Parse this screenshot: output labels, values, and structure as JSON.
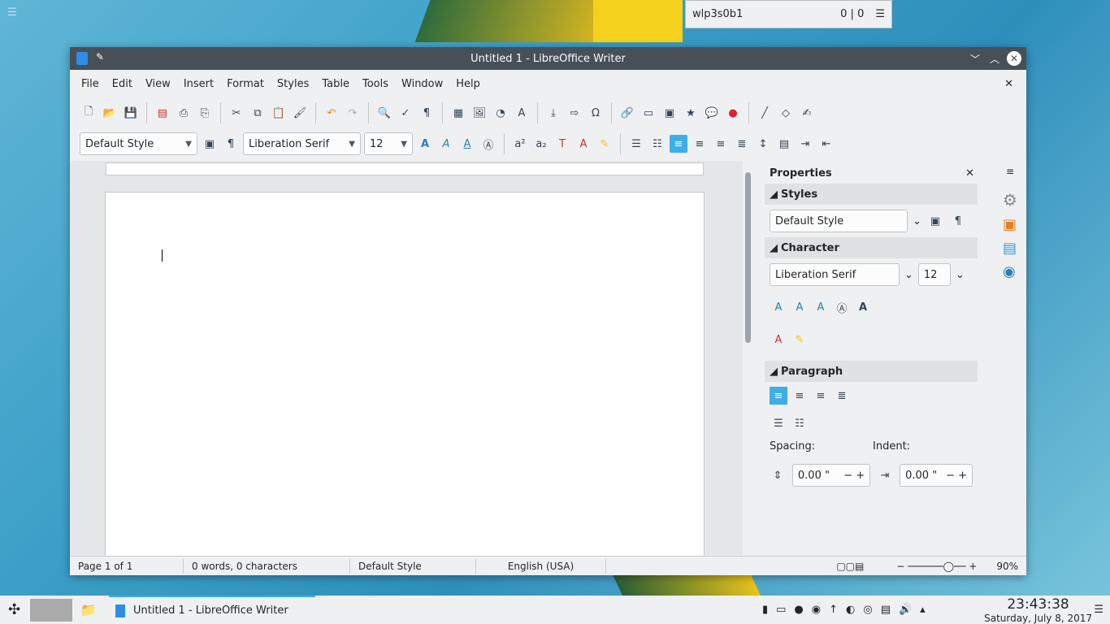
{
  "desktop": {
    "menu_icon": "hamburger-icon"
  },
  "network_widget": {
    "name": "wlp3s0b1",
    "counts": "0 | 0"
  },
  "window": {
    "title": "Untitled 1 - LibreOffice Writer",
    "menu": [
      "File",
      "Edit",
      "View",
      "Insert",
      "Format",
      "Styles",
      "Table",
      "Tools",
      "Window",
      "Help"
    ],
    "formatting": {
      "paragraph_style": "Default Style",
      "font_name": "Liberation Serif",
      "font_size": "12"
    }
  },
  "sidebar": {
    "title": "Properties",
    "styles_header": "Styles",
    "style_value": "Default Style",
    "character_header": "Character",
    "font_name": "Liberation Serif",
    "font_size": "12",
    "paragraph_header": "Paragraph",
    "spacing_label": "Spacing:",
    "indent_label": "Indent:",
    "spacing_value": "0.00 \"",
    "indent_value": "0.00 \""
  },
  "statusbar": {
    "page": "Page 1 of 1",
    "words": "0 words, 0 characters",
    "style": "Default Style",
    "language": "English (USA)",
    "zoom": "90%"
  },
  "taskbar": {
    "task_title": "Untitled 1 - LibreOffice Writer",
    "time": "23:43:38",
    "date": "Saturday, July 8, 2017"
  }
}
